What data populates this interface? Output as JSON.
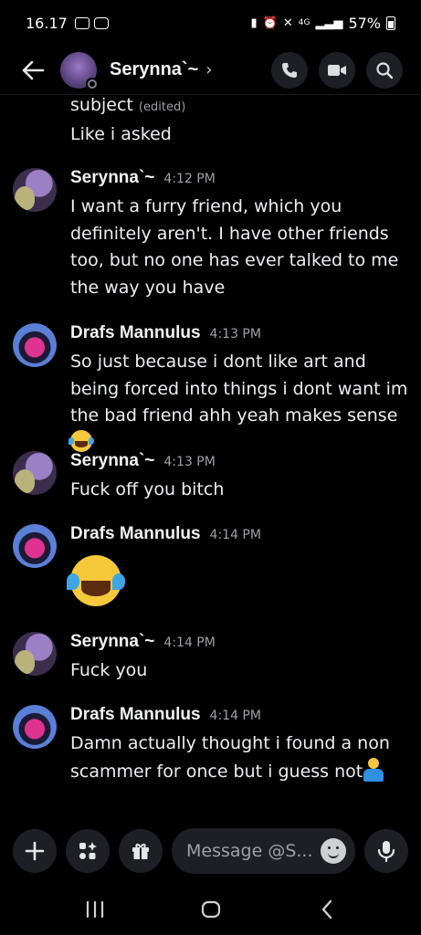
{
  "status_bar": {
    "time": "16.17",
    "network": "4G",
    "battery": "57%",
    "icons": [
      "gallery-icon",
      "youtube-icon",
      "battery-saver-icon",
      "alarm-icon",
      "mute-icon",
      "signal-icon",
      "battery-icon"
    ]
  },
  "header": {
    "title": "Serynna`~",
    "chevron": "›",
    "actions": [
      "call-icon",
      "video-icon",
      "search-icon"
    ]
  },
  "messages": {
    "continued": {
      "line1": "subject",
      "edited": "(edited)",
      "line2": "Like i asked"
    },
    "items": [
      {
        "author": "Serynna`~",
        "time": "4:12 PM",
        "text": "I want a furry friend, which you definitely aren't. I have other friends too, but no one has ever talked to me the way you have",
        "emoji": ""
      },
      {
        "author": "Drafs Mannulus",
        "time": "4:13 PM",
        "text": "So just because i dont like art and being forced into things i dont want im the bad friend ahh yeah makes sense",
        "emoji": "rolling-on-floor-laughing"
      },
      {
        "author": "Serynna`~",
        "time": "4:13 PM",
        "text": "Fuck off you bitch",
        "emoji": ""
      },
      {
        "author": "Drafs Mannulus",
        "time": "4:14 PM",
        "text": "",
        "emoji": "rolling-on-floor-laughing"
      },
      {
        "author": "Serynna`~",
        "time": "4:14 PM",
        "text": "Fuck you",
        "emoji": ""
      },
      {
        "author": "Drafs Mannulus",
        "time": "4:14 PM",
        "text": "Damn actually thought i found a non scammer for once but i guess not",
        "emoji": "person-shrugging"
      }
    ]
  },
  "composer": {
    "placeholder": "Message @S...",
    "buttons": [
      "plus-icon",
      "apps-icon",
      "gift-icon",
      "emoji-icon",
      "microphone-icon"
    ]
  },
  "navbar": {
    "buttons": [
      "recent-apps-icon",
      "home-icon",
      "back-icon"
    ]
  },
  "colors": {
    "background": "#000000",
    "surface": "#1e1f24",
    "text": "#f2f3f5",
    "muted": "#9ea0a6"
  }
}
